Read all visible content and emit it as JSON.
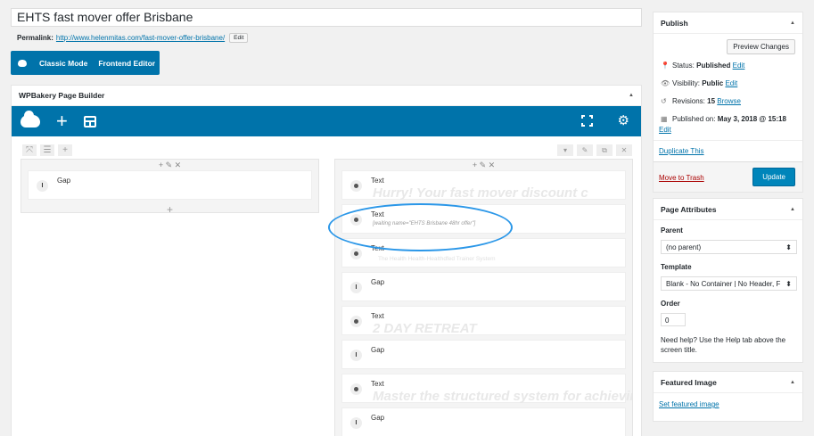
{
  "post": {
    "title": "EHTS fast mover offer Brisbane",
    "permalink_label": "Permalink:",
    "permalink_url": "http://www.helenmitas.com/fast-mover-offer-brisbane/",
    "permalink_edit": "Edit"
  },
  "mode_bar": {
    "classic": "Classic Mode",
    "frontend": "Frontend Editor"
  },
  "builder": {
    "title": "WPBakery Page Builder",
    "left_column": [
      {
        "type": "gap",
        "name": "Gap"
      }
    ],
    "right_column": [
      {
        "type": "text",
        "name": "Text",
        "preview": "Hurry! Your fast mover discount c"
      },
      {
        "type": "text",
        "name": "Text",
        "small": "[waiting name=\"EHTS Brisbane 48hr offer\"]"
      },
      {
        "type": "text",
        "name": "Text",
        "faint": "The Health Health-Healthdfed Trainer System"
      },
      {
        "type": "gap",
        "name": "Gap"
      },
      {
        "type": "text",
        "name": "Text",
        "preview": "2 DAY RETREAT"
      },
      {
        "type": "gap",
        "name": "Gap"
      },
      {
        "type": "text",
        "name": "Text",
        "preview": "Master the structured system for achievir"
      },
      {
        "type": "gap",
        "name": "Gap"
      }
    ]
  },
  "publish": {
    "title": "Publish",
    "preview_button": "Preview Changes",
    "status_label": "Status:",
    "status_value": "Published",
    "status_edit": "Edit",
    "visibility_label": "Visibility:",
    "visibility_value": "Public",
    "visibility_edit": "Edit",
    "revisions_label": "Revisions:",
    "revisions_value": "15",
    "revisions_link": "Browse",
    "published_label": "Published on:",
    "published_value": "May 3, 2018 @ 15:18",
    "published_edit": "Edit",
    "duplicate": "Duplicate This",
    "trash": "Move to Trash",
    "update": "Update"
  },
  "page_attributes": {
    "title": "Page Attributes",
    "parent_label": "Parent",
    "parent_value": "(no parent)",
    "template_label": "Template",
    "template_value": "Blank - No Container | No Header, F",
    "order_label": "Order",
    "order_value": "0",
    "help": "Need help? Use the Help tab above the screen title."
  },
  "featured_image": {
    "title": "Featured Image",
    "link": "Set featured image"
  },
  "colors": {
    "accent": "#0073aa",
    "highlight_ellipse": "#2b97e8",
    "update_button": "#0085ba",
    "trash": "#aa0000"
  }
}
